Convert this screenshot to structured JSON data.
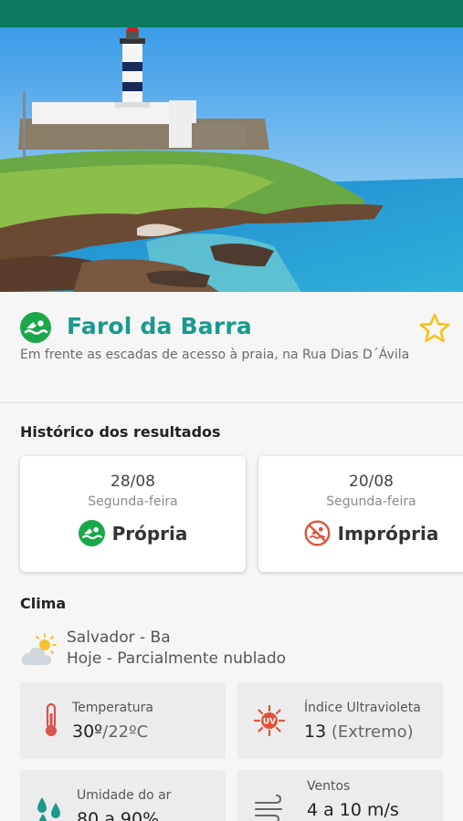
{
  "colors": {
    "status_bar": "#0b7a5e",
    "title": "#1a9a8c",
    "propria": "#1aa84a",
    "impropria": "#e0533a",
    "star": "#f4c21b"
  },
  "beach": {
    "title": "Farol da Barra",
    "subtitle": "Em frente as escadas de acesso à praia, na Rua Dias D´Ávila",
    "icon": "swimmer-icon",
    "favorite_icon": "star-outline-icon"
  },
  "history": {
    "label": "Histórico dos resultados",
    "results": [
      {
        "date": "28/08",
        "day": "Segunda-feira",
        "status": "Própria",
        "icon": "swimmer-icon"
      },
      {
        "date": "20/08",
        "day": "Segunda-feira",
        "status": "Imprópria",
        "icon": "no-swimming-icon"
      }
    ]
  },
  "clima": {
    "label": "Clima",
    "city": "Salvador - Ba",
    "forecast": "Hoje - Parcialmente nublado",
    "weather_icon": "partly-cloudy-icon",
    "cards": {
      "temperature": {
        "label": "Temperatura",
        "value": "30º",
        "sub": "/22ºC",
        "icon": "thermometer-icon"
      },
      "uv": {
        "label": "Índice Ultravioleta",
        "value": "13",
        "sub": " (Extremo)",
        "icon": "uv-sun-icon"
      },
      "humidity": {
        "label": "Umidade do ar",
        "value": "80 a 90%",
        "icon": "water-drops-icon"
      },
      "wind": {
        "label": "Ventos",
        "value": "4 a 10 m/s",
        "icon": "wind-icon"
      }
    }
  }
}
